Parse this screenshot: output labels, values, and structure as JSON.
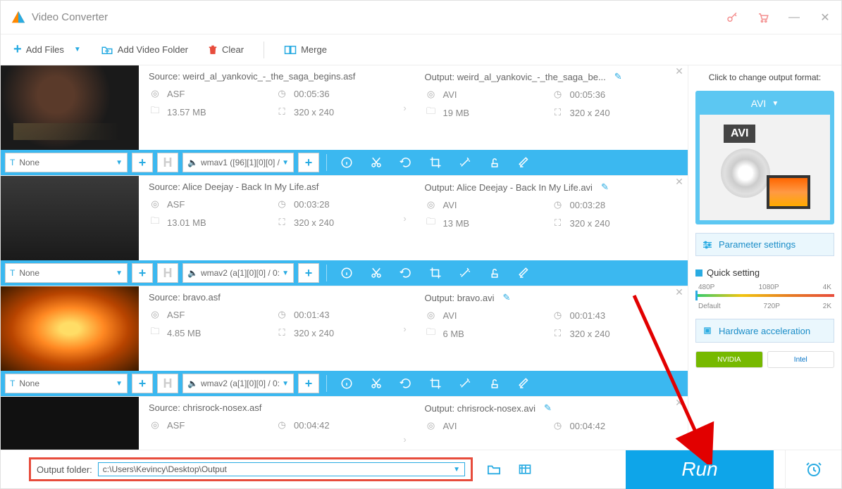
{
  "app": {
    "title": "Video Converter"
  },
  "toolbar": {
    "add_files": "Add Files",
    "add_folder": "Add Video Folder",
    "clear": "Clear",
    "merge": "Merge"
  },
  "rows": [
    {
      "source_label": "Source: weird_al_yankovic_-_the_saga_begins.asf",
      "output_label": "Output: weird_al_yankovic_-_the_saga_be...",
      "src_fmt": "ASF",
      "src_dur": "00:05:36",
      "src_size": "13.57 MB",
      "src_res": "320 x 240",
      "out_fmt": "AVI",
      "out_dur": "00:05:36",
      "out_size": "19 MB",
      "out_res": "320 x 240",
      "subtitle": "None",
      "audio": "wmav1 ([96][1][0][0] /"
    },
    {
      "source_label": "Source: Alice Deejay - Back In My Life.asf",
      "output_label": "Output: Alice Deejay - Back In My Life.avi",
      "src_fmt": "ASF",
      "src_dur": "00:03:28",
      "src_size": "13.01 MB",
      "src_res": "320 x 240",
      "out_fmt": "AVI",
      "out_dur": "00:03:28",
      "out_size": "13 MB",
      "out_res": "320 x 240",
      "subtitle": "None",
      "audio": "wmav2 (a[1][0][0] / 0:"
    },
    {
      "source_label": "Source: bravo.asf",
      "output_label": "Output: bravo.avi",
      "src_fmt": "ASF",
      "src_dur": "00:01:43",
      "src_size": "4.85 MB",
      "src_res": "320 x 240",
      "out_fmt": "AVI",
      "out_dur": "00:01:43",
      "out_size": "6 MB",
      "out_res": "320 x 240",
      "subtitle": "None",
      "audio": "wmav2 (a[1][0][0] / 0:"
    },
    {
      "source_label": "Source: chrisrock-nosex.asf",
      "output_label": "Output: chrisrock-nosex.avi",
      "src_fmt": "ASF",
      "src_dur": "00:04:42",
      "src_size": "",
      "src_res": "",
      "out_fmt": "AVI",
      "out_dur": "00:04:42",
      "out_size": "",
      "out_res": "",
      "subtitle": "None",
      "audio": ""
    }
  ],
  "sidebar": {
    "change_fmt": "Click to change output format:",
    "fmt_name": "AVI",
    "fmt_badge": "AVI",
    "param_settings": "Parameter settings",
    "quick_setting": "Quick setting",
    "scale": {
      "a": "480P",
      "b": "1080P",
      "c": "4K",
      "d": "Default",
      "e": "720P",
      "f": "2K"
    },
    "hw_accel": "Hardware acceleration",
    "nvidia": "NVIDIA",
    "intel": "Intel"
  },
  "footer": {
    "label": "Output folder:",
    "path": "c:\\Users\\Kevincy\\Desktop\\Output",
    "run": "Run"
  }
}
